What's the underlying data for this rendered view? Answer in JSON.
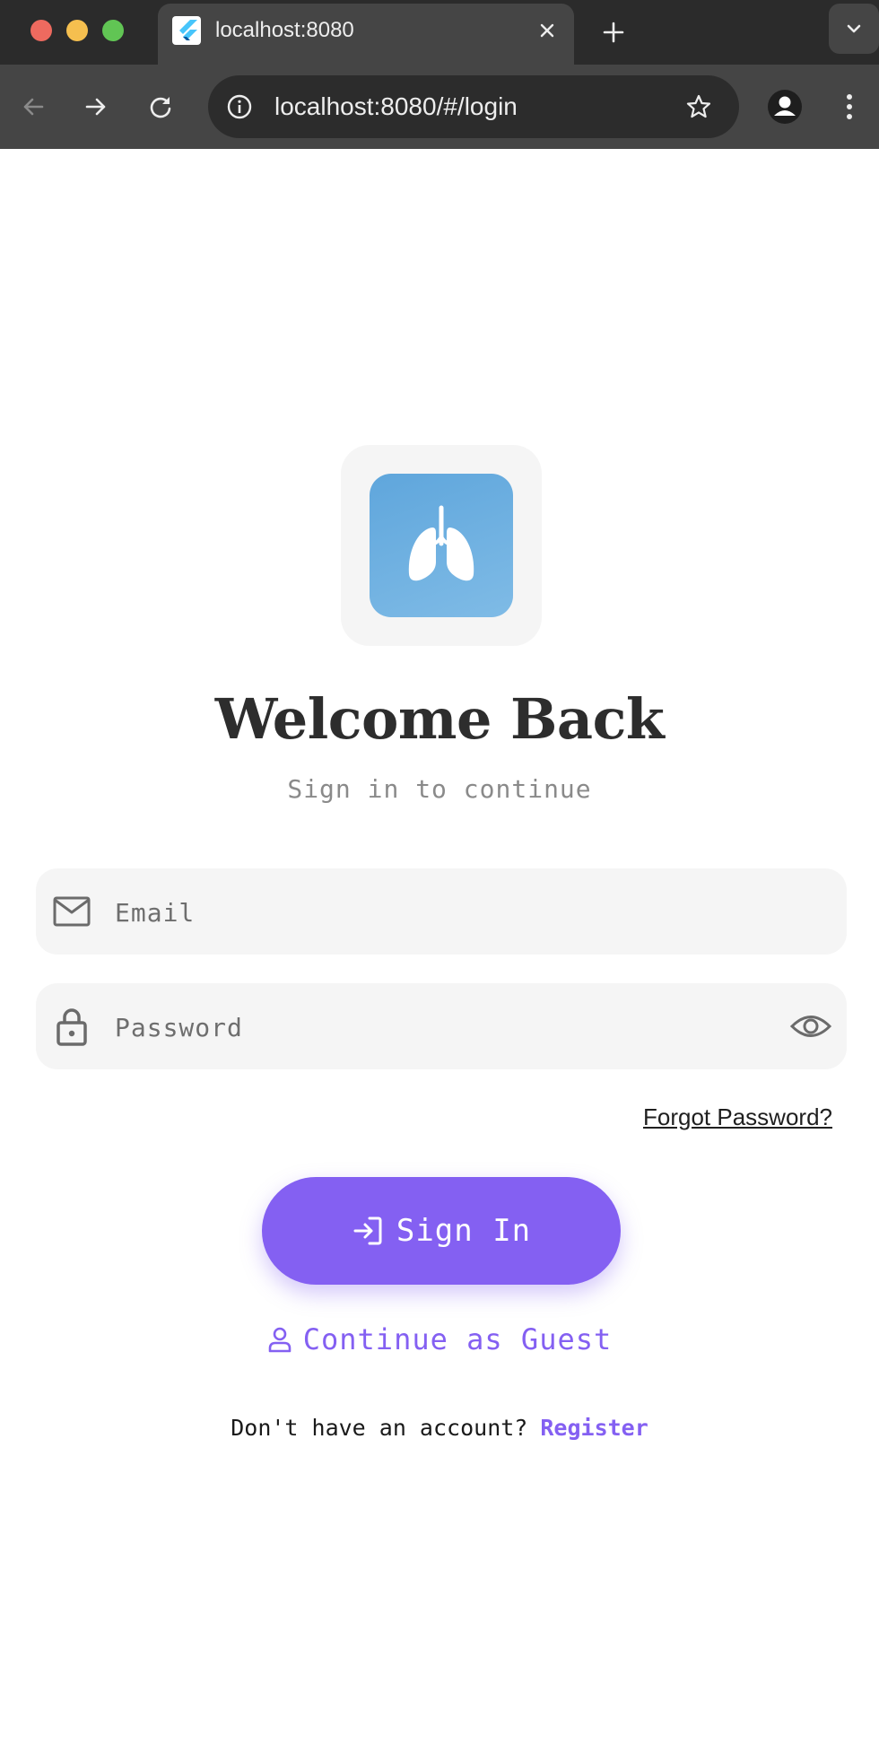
{
  "browser": {
    "tab_title": "localhost:8080",
    "url": "localhost:8080/#/login"
  },
  "login": {
    "title": "Welcome Back",
    "subtitle": "Sign in to continue",
    "email_placeholder": "Email",
    "password_placeholder": "Password",
    "forgot_password": "Forgot Password?",
    "sign_in": "Sign In",
    "guest": "Continue as Guest",
    "no_account": "Don't have an account?",
    "register": "Register"
  },
  "colors": {
    "accent": "#8460f2",
    "logo_bg": "#6aaee0",
    "field_bg": "#f5f5f5",
    "title": "#2d2d2d"
  },
  "icons": {
    "logo": "lungs-icon",
    "email": "mail-icon",
    "password": "lock-icon",
    "visibility": "eye-icon",
    "sign_in": "login-icon",
    "guest": "person-icon"
  }
}
